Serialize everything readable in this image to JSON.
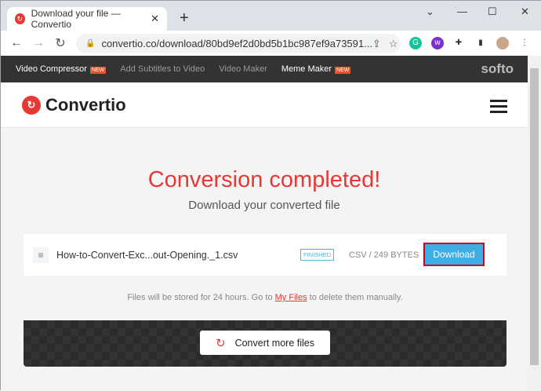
{
  "browser": {
    "tab_title": "Download your file — Convertio",
    "url": "convertio.co/download/80bd9ef2d0bd5b1bc987ef9a73591..."
  },
  "topnav": {
    "items": [
      "Video Compressor",
      "Add Subtitles to Video",
      "Video Maker",
      "Meme Maker"
    ],
    "new_badge": "NEW",
    "brand": "softo"
  },
  "header": {
    "logo": "Convertio"
  },
  "main": {
    "title": "Conversion completed!",
    "subtitle": "Download your converted file",
    "file": {
      "name": "How-to-Convert-Exc...out-Opening._1.csv",
      "status": "FINISHED",
      "size": "CSV / 249 BYTES",
      "download_label": "Download"
    },
    "info_before": "Files will be stored for 24 hours. Go to ",
    "info_link": "My Files",
    "info_after": " to delete them manually.",
    "convert_more": "Convert more files"
  }
}
